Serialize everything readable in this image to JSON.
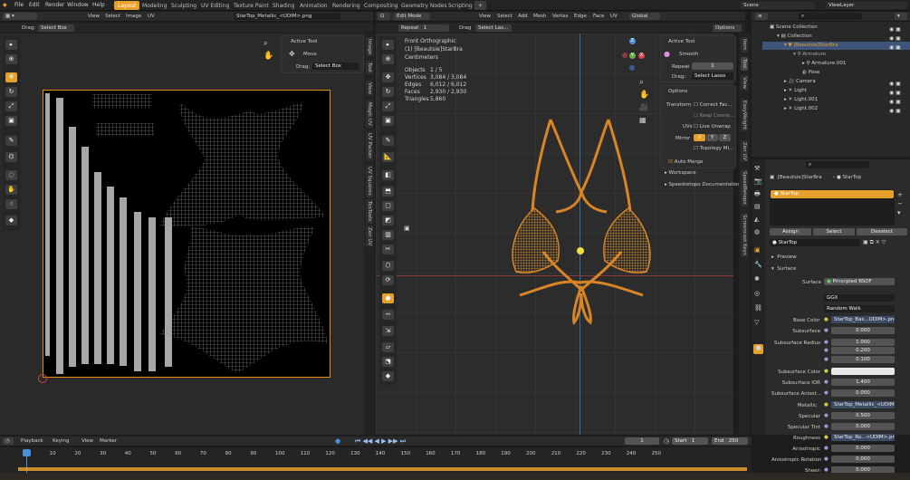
{
  "top_menu": [
    "File",
    "Edit",
    "Render",
    "Window",
    "Help"
  ],
  "workspace_tabs": [
    "Layout",
    "Modeling",
    "Sculpting",
    "UV Editing",
    "Texture Paint",
    "Shading",
    "Animation",
    "Rendering",
    "Compositing",
    "Geometry Nodes",
    "Scripting"
  ],
  "scene": {
    "name": "Scene",
    "view_layer": "ViewLayer"
  },
  "uv_editor": {
    "menus": [
      "View",
      "Select",
      "Image",
      "UV"
    ],
    "image_name": "StarTop_Metallic_<UDIM>.png",
    "drag_label": "Drag:",
    "drag_value": "Select Box",
    "active_tool": {
      "title": "Active Tool",
      "tool": "Move",
      "drag_label": "Drag:",
      "drag_value": "Select Box"
    },
    "side_tabs": [
      "Image",
      "Tool",
      "View",
      "Magic UV",
      "UV Packer",
      "UV Squares",
      "TexTools",
      "Zen UV"
    ]
  },
  "viewport": {
    "mode": "Edit Mode",
    "menus": [
      "View",
      "Select",
      "Add",
      "Mesh",
      "Vertex",
      "Edge",
      "Face",
      "UV"
    ],
    "orientation": "Global",
    "options_label": "Options",
    "repeat_label": "Repeat",
    "repeat_value": "1",
    "drag_label": "Drag",
    "drag_value": "Select Las...",
    "view_name": "Front Orthographic",
    "object_name": "(1) [Beautsie]StarBra",
    "units": "Centimeters",
    "stats": [
      {
        "label": "Objects",
        "value": "1 / 5"
      },
      {
        "label": "Vertices",
        "value": "3,084 / 3,084"
      },
      {
        "label": "Edges",
        "value": "6,012 / 6,012"
      },
      {
        "label": "Faces",
        "value": "2,930 / 2,930"
      },
      {
        "label": "Triangles",
        "value": "5,860"
      }
    ],
    "axes": {
      "x": "X",
      "y": "Y",
      "z": "Z"
    },
    "side_tabs": [
      "Item",
      "Tool",
      "View",
      "EasyWeight",
      "Zen UV",
      "SpeedRetopo",
      "Screencast Keys"
    ]
  },
  "tool_panel": {
    "title": "Active Tool",
    "tool": "Smooth",
    "repeat_label": "Repeat",
    "repeat_value": "1",
    "drag_label": "Drag:",
    "drag_value": "Select Lasso",
    "options_title": "Options",
    "transform_label": "Transform",
    "correct_face": "Correct Fac...",
    "keep_connected": "Keep Conne...",
    "uvs_label": "UVs",
    "live_unwrap": "Live Unwrap",
    "mirror_label": "Mirror",
    "mirror_axes": [
      "X",
      "Y",
      "Z"
    ],
    "topology": "Topology Mi...",
    "auto_merge": "Auto Merge",
    "workspace": "Workspace",
    "speedretopo_doc": "Speedretopo Documentation"
  },
  "outliner": {
    "rows": [
      {
        "name": "Scene Collection",
        "indent": 0
      },
      {
        "name": "Collection",
        "indent": 1
      },
      {
        "name": "[Beautsie]StarBra",
        "indent": 2,
        "selected": true
      },
      {
        "name": "Armature",
        "indent": 3
      },
      {
        "name": "Armature.001",
        "indent": 4
      },
      {
        "name": "Pose",
        "indent": 4
      },
      {
        "name": "Camera",
        "indent": 2
      },
      {
        "name": "Light",
        "indent": 2
      },
      {
        "name": "Light.001",
        "indent": 2
      },
      {
        "name": "Light.002",
        "indent": 2
      }
    ]
  },
  "properties": {
    "object": "[Beautsie]StarBra",
    "material_crumb": "StarTop",
    "slot_name": "StarTop",
    "assign": "Assign",
    "select": "Select",
    "deselect": "Deselect",
    "material_name": "StarTop",
    "preview": "Preview",
    "surface_section": "Surface",
    "surface_label": "Surface",
    "surface_value": "Principled BSDF",
    "distribution": "GGX",
    "subsurface_method": "Random Walk",
    "params": [
      {
        "label": "Base Color",
        "value": "StarTop_Bas...UDIM>.png",
        "kind": "tex"
      },
      {
        "label": "Subsurface",
        "value": "0.000",
        "kind": "num"
      },
      {
        "label": "Subsurface Radius",
        "value": "1.000",
        "kind": "num"
      },
      {
        "label": "",
        "value": "0.200",
        "kind": "num"
      },
      {
        "label": "",
        "value": "0.100",
        "kind": "num"
      },
      {
        "label": "Subsurface Color",
        "value": "",
        "kind": "color"
      },
      {
        "label": "Subsurface IOR",
        "value": "1.400",
        "kind": "num"
      },
      {
        "label": "Subsurface Anisot...",
        "value": "0.000",
        "kind": "num"
      },
      {
        "label": "Metallic",
        "value": "StarTop_Metallic_<UDIM...",
        "kind": "tex"
      },
      {
        "label": "Specular",
        "value": "0.500",
        "kind": "num"
      },
      {
        "label": "Specular Tint",
        "value": "0.000",
        "kind": "num"
      },
      {
        "label": "Roughness",
        "value": "StarTop_Ro...<UDIM>.png",
        "kind": "tex"
      },
      {
        "label": "Anisotropic",
        "value": "0.000",
        "kind": "num"
      },
      {
        "label": "Anisotropic Rotation",
        "value": "0.000",
        "kind": "num"
      },
      {
        "label": "Sheen",
        "value": "0.000",
        "kind": "num"
      }
    ]
  },
  "timeline": {
    "menus": [
      "Playback",
      "Keying",
      "View",
      "Marker"
    ],
    "current_frame": "1",
    "start_label": "Start",
    "start": "1",
    "end_label": "End",
    "end": "250",
    "ticks": [
      "1",
      "10",
      "20",
      "30",
      "40",
      "50",
      "60",
      "70",
      "80",
      "90",
      "100",
      "110",
      "120",
      "130",
      "140",
      "150",
      "160",
      "170",
      "180",
      "190",
      "200",
      "210",
      "220",
      "230",
      "240",
      "250"
    ]
  },
  "colors": {
    "accent": "#e6a12b",
    "wire": "#e38a25",
    "selected_row": "#3f5479",
    "background": "#1d1d1d"
  }
}
